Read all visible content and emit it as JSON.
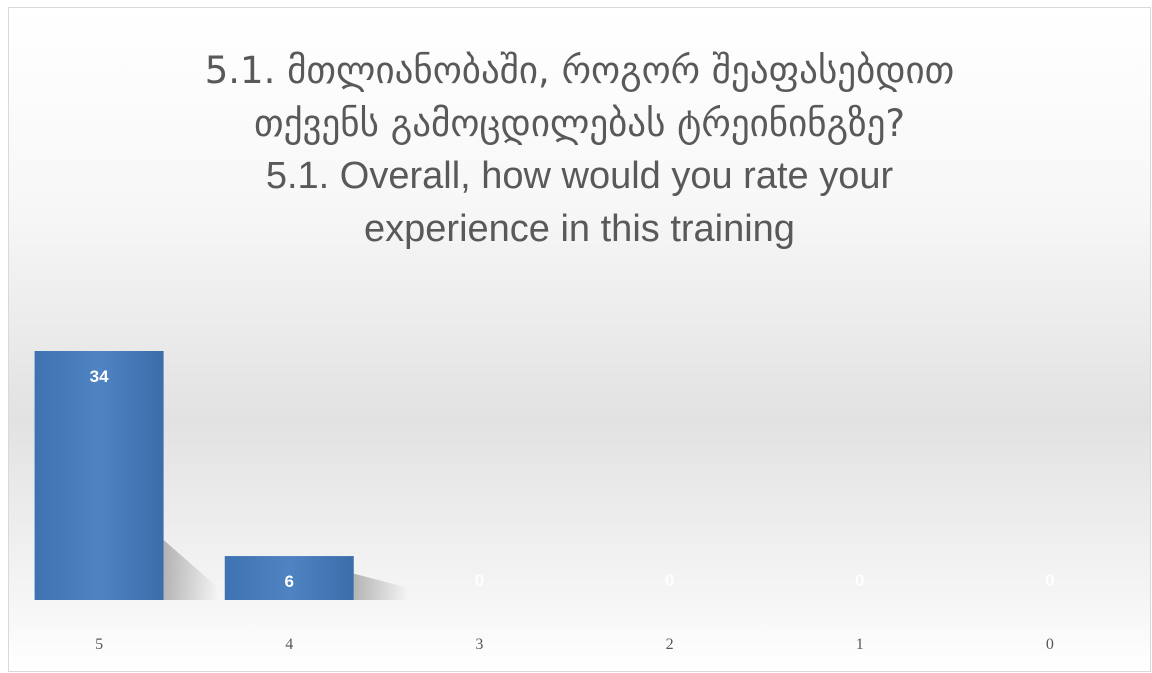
{
  "chart_data": {
    "type": "bar",
    "title_lines": [
      "5.1. მთლიანობაში, როგორ შეაფასებდით",
      "თქვენს გამოცდილებას ტრეინინგზე?",
      "5.1. Overall, how would you rate your",
      "experience in this training"
    ],
    "categories": [
      "5",
      "4",
      "3",
      "2",
      "1",
      "0"
    ],
    "values": [
      34,
      6,
      0,
      0,
      0,
      0
    ],
    "data_labels": [
      "34",
      "6",
      "0",
      "0",
      "0",
      "0"
    ],
    "xlabel": "",
    "ylabel": "",
    "ylim": [
      0,
      34
    ],
    "grid": false,
    "legend": "none",
    "colors": {
      "bar": "#4a7ebb",
      "bar_top": "#5b8fcc",
      "bar_bottom": "#3a6aa8",
      "title": "#595959",
      "tick": "#595959"
    }
  }
}
